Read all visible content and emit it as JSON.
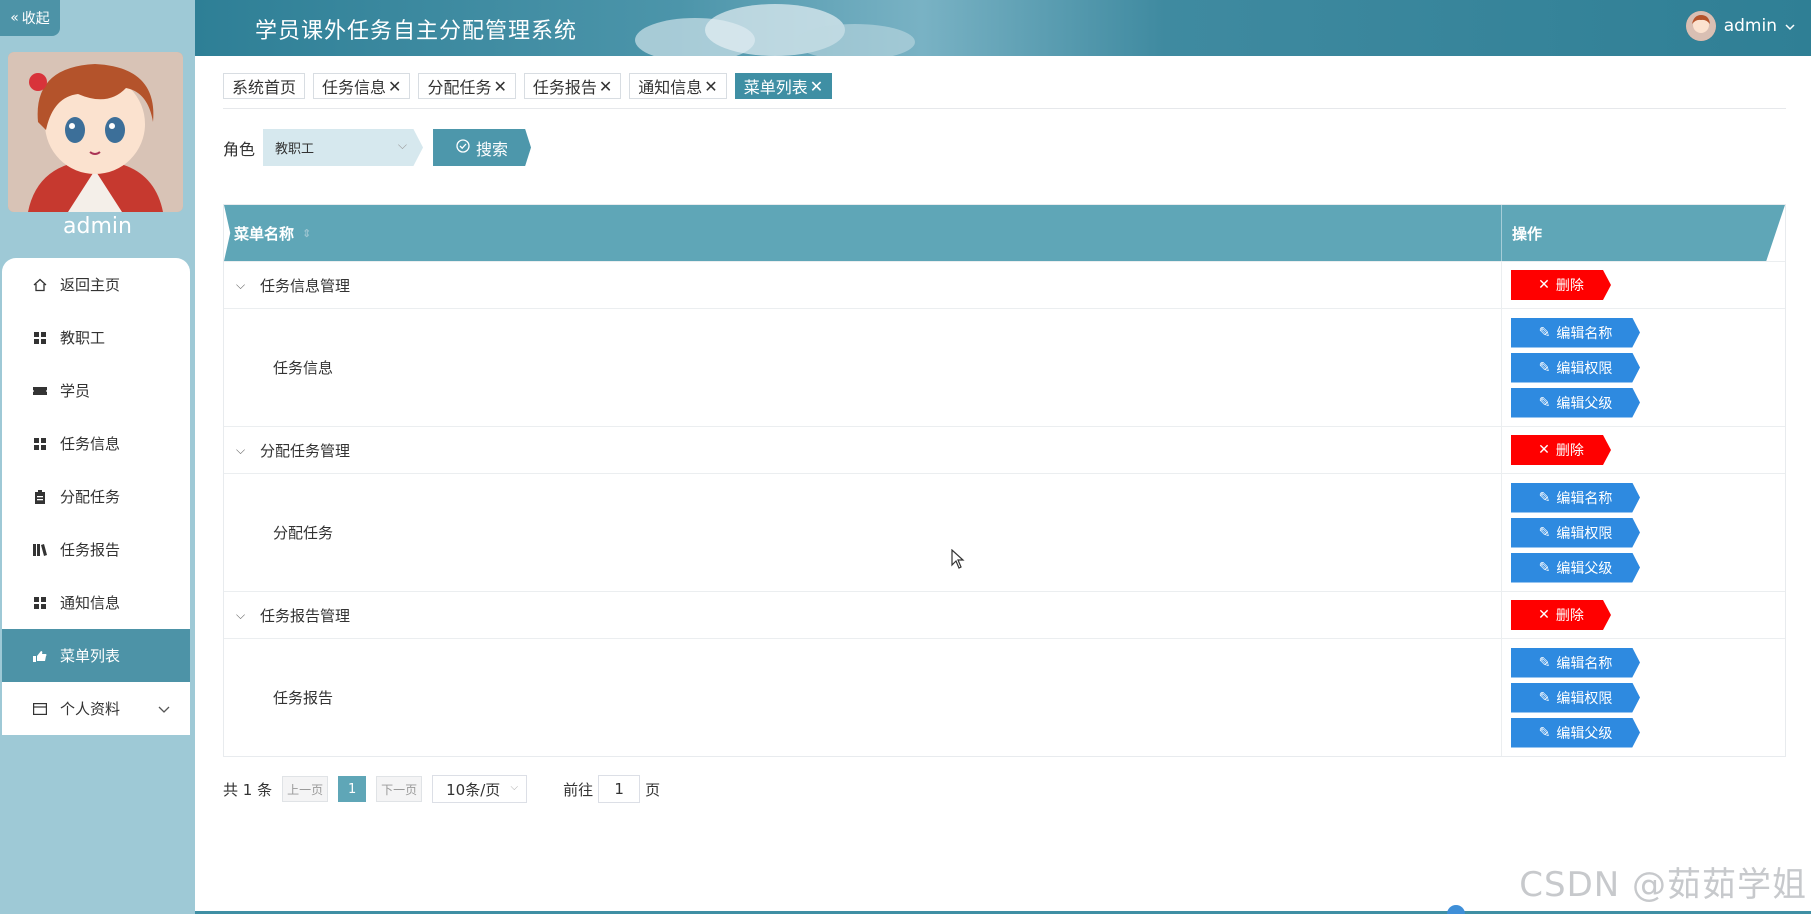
{
  "sidebar": {
    "collapse_label": "收起",
    "username": "admin",
    "menu": [
      {
        "label": "返回主页",
        "icon": "home-icon"
      },
      {
        "label": "教职工",
        "icon": "grid-icon"
      },
      {
        "label": "学员",
        "icon": "ticket-icon"
      },
      {
        "label": "任务信息",
        "icon": "grid-icon"
      },
      {
        "label": "分配任务",
        "icon": "clipboard-icon"
      },
      {
        "label": "任务报告",
        "icon": "books-icon"
      },
      {
        "label": "通知信息",
        "icon": "grid-icon"
      },
      {
        "label": "菜单列表",
        "icon": "hand-icon",
        "active": true
      },
      {
        "label": "个人资料",
        "icon": "card-icon",
        "expandable": true
      }
    ]
  },
  "header": {
    "title": "学员课外任务自主分配管理系统",
    "user": "admin"
  },
  "tabs": [
    {
      "label": "系统首页",
      "closable": false
    },
    {
      "label": "任务信息",
      "closable": true
    },
    {
      "label": "分配任务",
      "closable": true
    },
    {
      "label": "任务报告",
      "closable": true
    },
    {
      "label": "通知信息",
      "closable": true
    },
    {
      "label": "菜单列表",
      "closable": true,
      "active": true
    }
  ],
  "search": {
    "role_label": "角色",
    "role_value": "教职工",
    "search_button": "搜索"
  },
  "table": {
    "col_name": "菜单名称",
    "col_op": "操作",
    "delete_label": "删除",
    "edit_name_label": "编辑名称",
    "edit_perm_label": "编辑权限",
    "edit_parent_label": "编辑父级",
    "groups": [
      {
        "parent": "任务信息管理",
        "child": "任务信息"
      },
      {
        "parent": "分配任务管理",
        "child": "分配任务"
      },
      {
        "parent": "任务报告管理",
        "child": "任务报告"
      }
    ]
  },
  "pagination": {
    "total": "共 1 条",
    "prev": "上一页",
    "page": "1",
    "next": "下一页",
    "page_size": "10条/页",
    "goto_label": "前往",
    "goto_value": "1",
    "page_unit": "页"
  },
  "watermark": "CSDN @茹茹学姐",
  "colors": {
    "primary": "#4d93a7",
    "delete": "#ff0000",
    "edit": "#2e8ae0"
  }
}
